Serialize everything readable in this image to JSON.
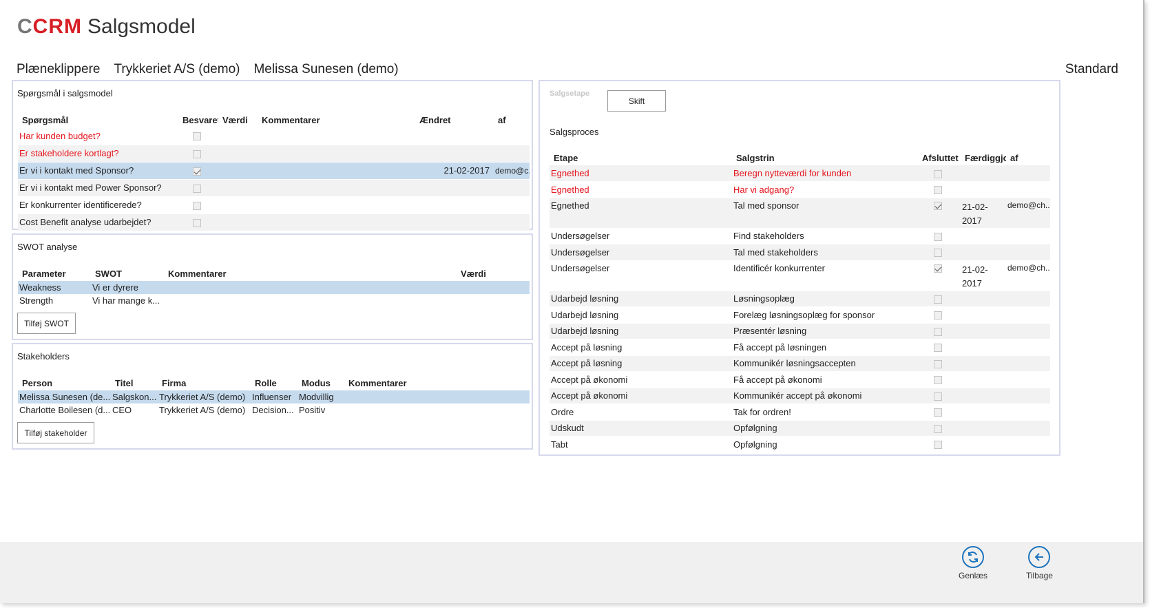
{
  "app": {
    "logo_c": "C",
    "logo_crm": "CRM",
    "title": "Salgsmodel"
  },
  "context": {
    "items": [
      "Plæneklippere",
      "Trykkeriet A/S (demo)",
      "Melissa Sunesen (demo)"
    ],
    "view": "Standard"
  },
  "questions": {
    "title": "Spørgsmål i salgsmodel",
    "headers": [
      "Spørgsmål",
      "Besvaret",
      "Værdi",
      "Kommentarer",
      "Ændret",
      "af"
    ],
    "rows": [
      {
        "question": "Har kunden budget?",
        "answered": false,
        "value": "",
        "comment": "",
        "changed": "",
        "by": "",
        "red": true
      },
      {
        "question": "Er stakeholdere kortlagt?",
        "answered": false,
        "value": "",
        "comment": "",
        "changed": "",
        "by": "",
        "red": true
      },
      {
        "question": "Er vi i kontakt med Sponsor?",
        "answered": true,
        "value": "",
        "comment": "",
        "changed": "21-02-2017",
        "by": "demo@c...",
        "red": false
      },
      {
        "question": "Er vi i kontakt med Power Sponsor?",
        "answered": false,
        "value": "",
        "comment": "",
        "changed": "",
        "by": "",
        "red": false
      },
      {
        "question": "Er konkurrenter identificerede?",
        "answered": false,
        "value": "",
        "comment": "",
        "changed": "",
        "by": "",
        "red": false
      },
      {
        "question": "Cost Benefit analyse udarbejdet?",
        "answered": false,
        "value": "",
        "comment": "",
        "changed": "",
        "by": "",
        "red": false
      }
    ]
  },
  "swot": {
    "title": "SWOT analyse",
    "headers": [
      "Parameter",
      "SWOT",
      "Kommentarer",
      "Værdi"
    ],
    "rows": [
      {
        "parameter": "Weakness",
        "swot": "Vi er dyrere",
        "comment": "",
        "value": ""
      },
      {
        "parameter": "Strength",
        "swot": "Vi har mange k...",
        "comment": "",
        "value": ""
      }
    ],
    "add_button": "Tilføj SWOT"
  },
  "stakeholders": {
    "title": "Stakeholders",
    "headers": [
      "Person",
      "Titel",
      "Firma",
      "Rolle",
      "Modus",
      "Kommentarer"
    ],
    "rows": [
      {
        "person": "Melissa Sunesen (de...",
        "title": "Salgskon...",
        "company": "Trykkeriet A/S (demo)",
        "role": "Influenser",
        "mode": "Modvillig",
        "comment": ""
      },
      {
        "person": "Charlotte Boilesen (d...",
        "title": "CEO",
        "company": "Trykkeriet A/S (demo)",
        "role": "Decision...",
        "mode": "Positiv",
        "comment": ""
      }
    ],
    "add_button": "Tilføj stakeholder"
  },
  "process": {
    "stage_label": "Salgsetape",
    "switch_button": "Skift",
    "title": "Salgsproces",
    "headers": [
      "Etape",
      "Salgstrin",
      "Afsluttet",
      "Færdiggjc",
      "af"
    ],
    "rows": [
      {
        "stage": "Egnethed",
        "step": "Beregn nytteværdi for kunden",
        "done": false,
        "date": "",
        "by": "",
        "red": true
      },
      {
        "stage": "Egnethed",
        "step": "Har vi adgang?",
        "done": false,
        "date": "",
        "by": "",
        "red": true
      },
      {
        "stage": "Egnethed",
        "step": "Tal med sponsor",
        "done": true,
        "date": "21-02-2017",
        "by": "demo@ch...",
        "red": false
      },
      {
        "stage": "Undersøgelser",
        "step": "Find stakeholders",
        "done": false,
        "date": "",
        "by": "",
        "red": false
      },
      {
        "stage": "Undersøgelser",
        "step": "Tal med stakeholders",
        "done": false,
        "date": "",
        "by": "",
        "red": false
      },
      {
        "stage": "Undersøgelser",
        "step": "Identificér konkurrenter",
        "done": true,
        "date": "21-02-2017",
        "by": "demo@ch...",
        "red": false
      },
      {
        "stage": "Udarbejd løsning",
        "step": "Løsningsoplæg",
        "done": false,
        "date": "",
        "by": "",
        "red": false
      },
      {
        "stage": "Udarbejd løsning",
        "step": "Forelæg løsningsoplæg for sponsor",
        "done": false,
        "date": "",
        "by": "",
        "red": false
      },
      {
        "stage": "Udarbejd løsning",
        "step": "Præsentér løsning",
        "done": false,
        "date": "",
        "by": "",
        "red": false
      },
      {
        "stage": "Accept på løsning",
        "step": "Få accept på løsningen",
        "done": false,
        "date": "",
        "by": "",
        "red": false
      },
      {
        "stage": "Accept på løsning",
        "step": "Kommunikér løsningsaccepten",
        "done": false,
        "date": "",
        "by": "",
        "red": false
      },
      {
        "stage": "Accept på økonomi",
        "step": "Få accept på økonomi",
        "done": false,
        "date": "",
        "by": "",
        "red": false
      },
      {
        "stage": "Accept på økonomi",
        "step": "Kommunikér accept på økonomi",
        "done": false,
        "date": "",
        "by": "",
        "red": false
      },
      {
        "stage": "Ordre",
        "step": "Tak for ordren!",
        "done": false,
        "date": "",
        "by": "",
        "red": false
      },
      {
        "stage": "Udskudt",
        "step": "Opfølgning",
        "done": false,
        "date": "",
        "by": "",
        "red": false
      },
      {
        "stage": "Tabt",
        "step": "Opfølgning",
        "done": false,
        "date": "",
        "by": "",
        "red": false
      }
    ]
  },
  "actions": {
    "reload": "Genlæs",
    "back": "Tilbage",
    "reload_icon": "refresh-icon",
    "back_icon": "arrow-left-icon"
  },
  "colors": {
    "accent": "#1e74bd",
    "required": "#e5141d",
    "selected_row": "#c5daed",
    "panel_border": "#d6d9ec"
  }
}
